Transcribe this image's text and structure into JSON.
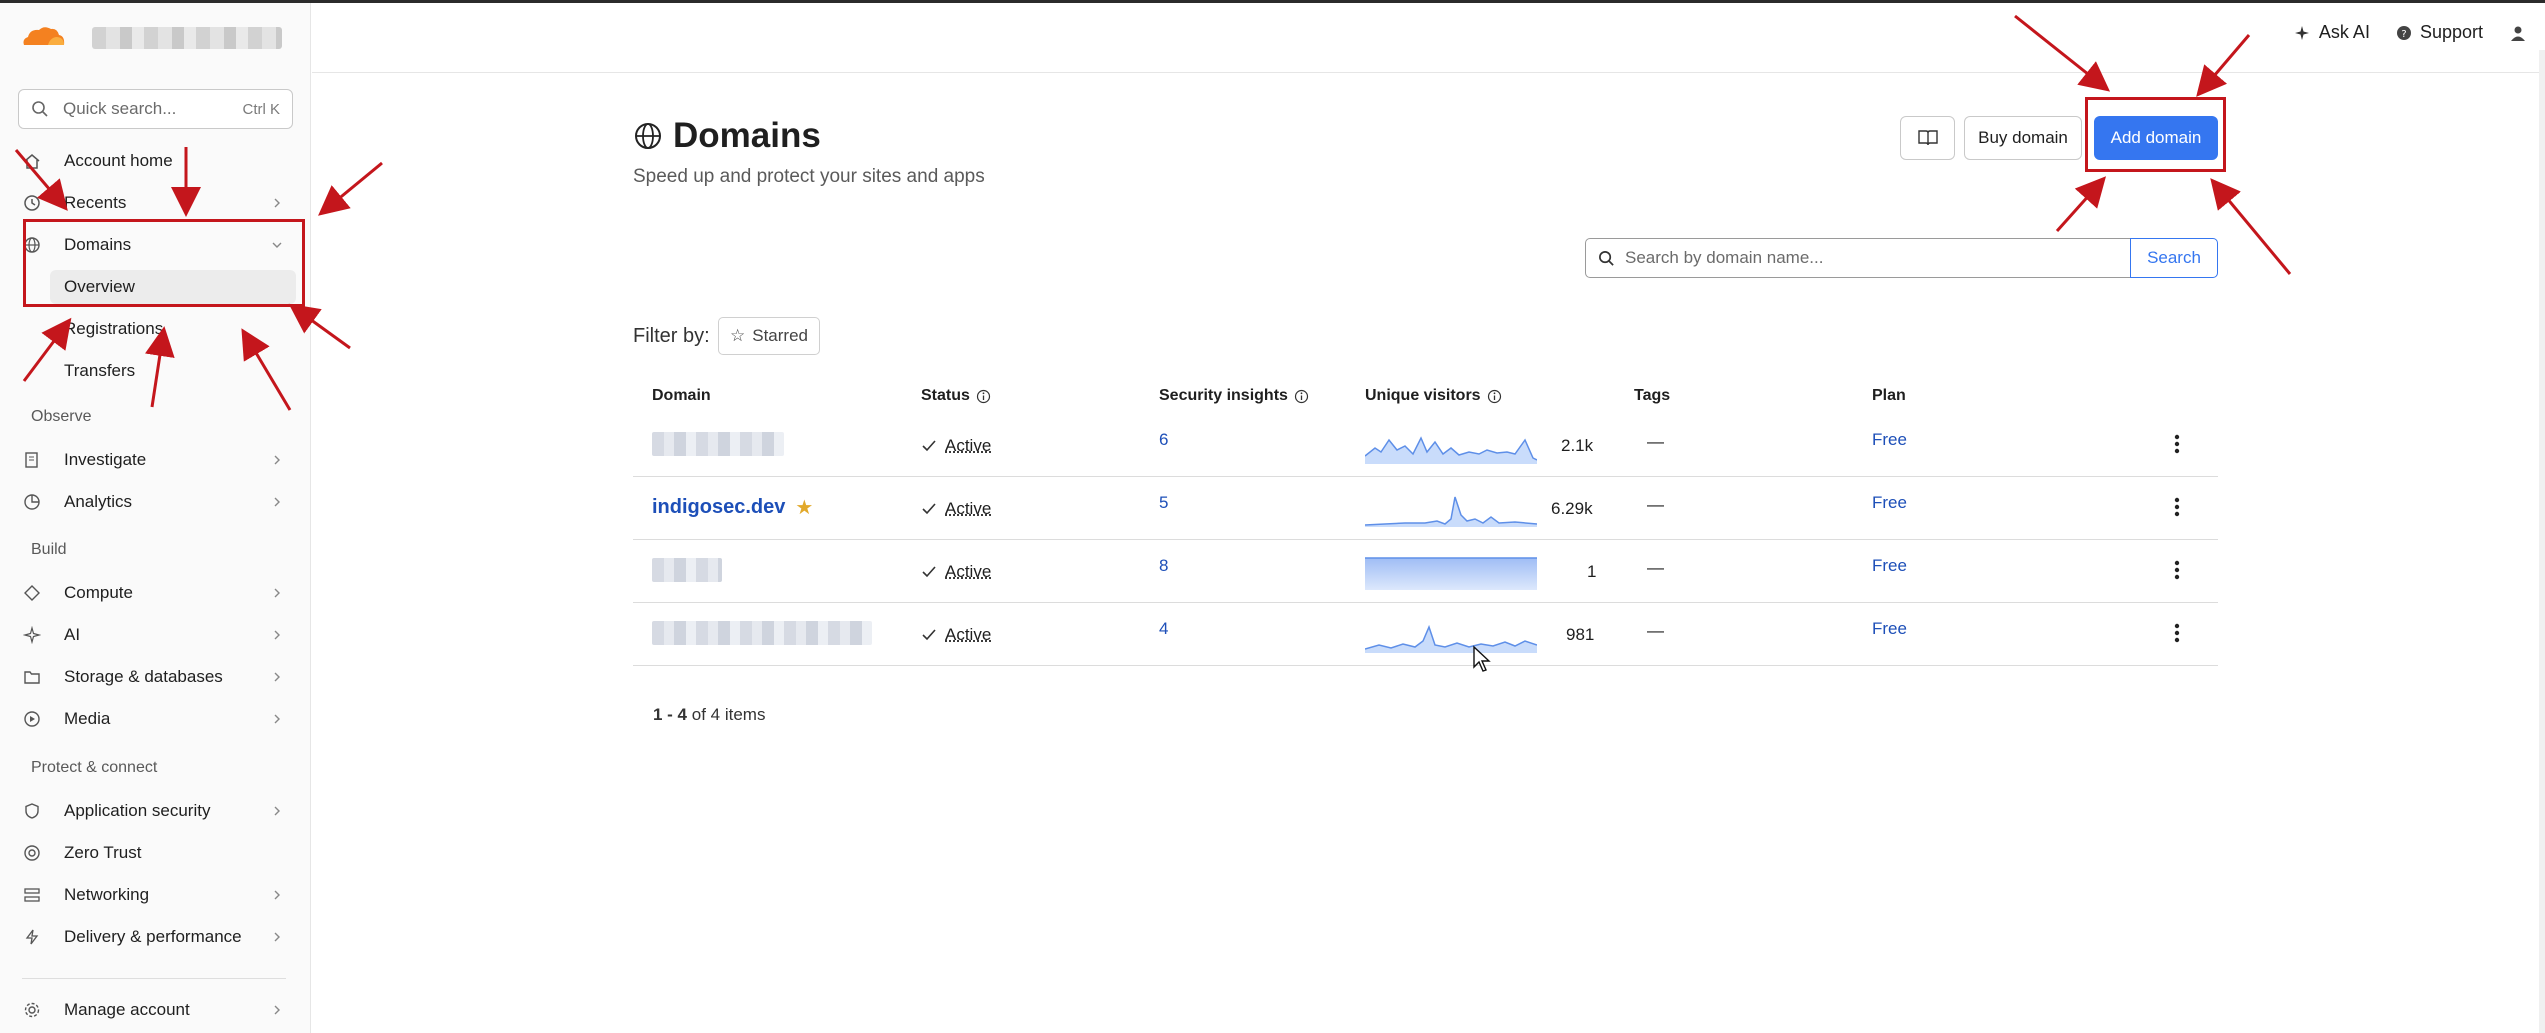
{
  "sidebar": {
    "search": {
      "placeholder": "Quick search...",
      "shortcut": "Ctrl K"
    },
    "items": [
      {
        "label": "Account home",
        "icon": "home-icon"
      },
      {
        "label": "Recents",
        "icon": "history-icon"
      },
      {
        "label": "Domains",
        "icon": "globe-icon"
      },
      {
        "label": "Overview"
      },
      {
        "label": "Registrations"
      },
      {
        "label": "Transfers"
      }
    ],
    "sections": {
      "observe": "Observe",
      "build": "Build",
      "protect": "Protect & connect"
    },
    "observe_items": [
      {
        "label": "Investigate",
        "icon": "investigate-icon"
      },
      {
        "label": "Analytics",
        "icon": "analytics-icon"
      }
    ],
    "build_items": [
      {
        "label": "Compute",
        "icon": "compute-icon"
      },
      {
        "label": "AI",
        "icon": "ai-sparkle-icon"
      },
      {
        "label": "Storage & databases",
        "icon": "storage-icon"
      },
      {
        "label": "Media",
        "icon": "media-icon"
      }
    ],
    "protect_items": [
      {
        "label": "Application security",
        "icon": "shield-icon"
      },
      {
        "label": "Zero Trust",
        "icon": "zero-trust-icon"
      },
      {
        "label": "Networking",
        "icon": "networking-icon"
      },
      {
        "label": "Delivery & performance",
        "icon": "lightning-icon"
      }
    ],
    "manage": {
      "label": "Manage account",
      "icon": "gear-icon"
    }
  },
  "topbar": {
    "ask_ai": "Ask AI",
    "support": "Support"
  },
  "header": {
    "title": "Domains",
    "subtitle": "Speed up and protect your sites and apps",
    "buy_label": "Buy domain",
    "add_label": "Add domain"
  },
  "search": {
    "placeholder": "Search by domain name...",
    "button": "Search"
  },
  "filter": {
    "label": "Filter by:",
    "starred": "Starred"
  },
  "table": {
    "columns": [
      "Domain",
      "Status",
      "Security insights",
      "Unique visitors",
      "Tags",
      "Plan"
    ],
    "rows": [
      {
        "domain": "",
        "status": "Active",
        "insights": "6",
        "visitors": "2.1k",
        "tags": "—",
        "plan": "Free"
      },
      {
        "domain": "indigosec.dev",
        "starred": true,
        "status": "Active",
        "insights": "5",
        "visitors": "6.29k",
        "tags": "—",
        "plan": "Free"
      },
      {
        "domain": "",
        "status": "Active",
        "insights": "8",
        "visitors": "1",
        "tags": "—",
        "plan": "Free"
      },
      {
        "domain": "",
        "status": "Active",
        "insights": "4",
        "visitors": "981",
        "tags": "—",
        "plan": "Free"
      }
    ]
  },
  "pagination": {
    "range": "1 - 4",
    "of_text": "of 4 items"
  },
  "colors": {
    "accent": "#3576f0",
    "link": "#1d4fb8",
    "annotation": "#c4161c",
    "star": "#e2a92b"
  }
}
